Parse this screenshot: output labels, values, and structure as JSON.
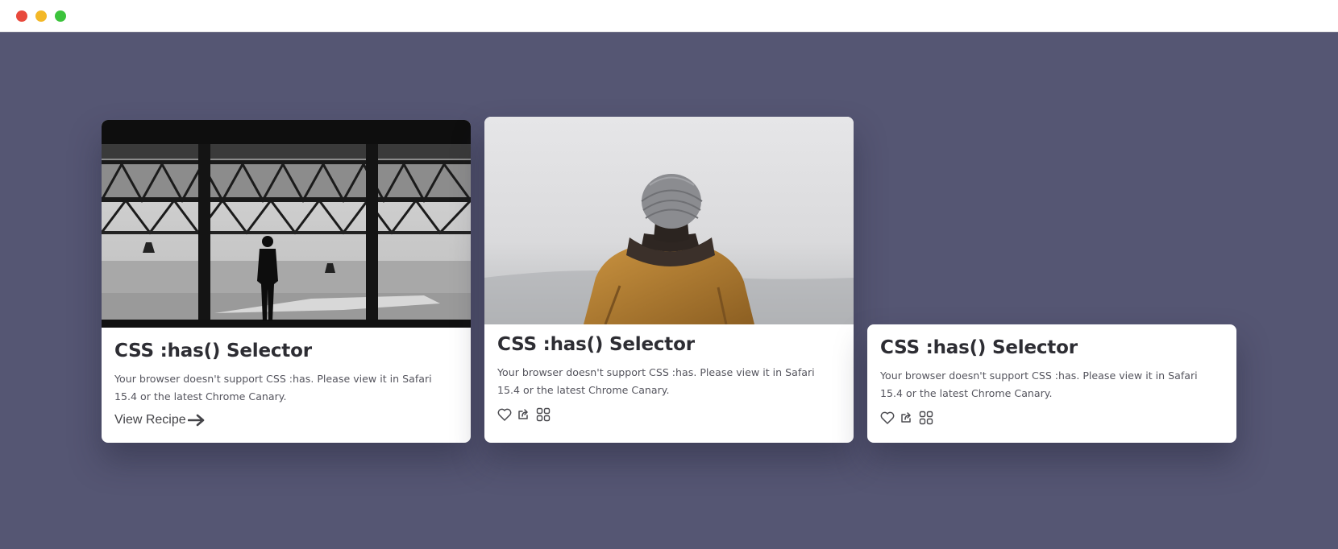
{
  "window": {
    "controls": {
      "close_color": "#e8493c",
      "minimize_color": "#f3b827",
      "zoom_color": "#3cc33c"
    }
  },
  "stage": {
    "background": "#555673"
  },
  "cards": [
    {
      "image": "man-silhouette-airport-window-photo",
      "title": "CSS :has() Selector",
      "text": "Your browser doesn't support CSS :has. Please view it in Safari 15.4 or the latest Chrome Canary.",
      "link_label": "View Recipe",
      "link_icon": "arrow-right-icon"
    },
    {
      "image": "person-knit-beanie-hooded-jacket-fog-photo",
      "title": "CSS :has() Selector",
      "text": "Your browser doesn't support CSS :has. Please view it in Safari 15.4 or the latest Chrome Canary.",
      "actions": [
        "heart-icon",
        "share-icon",
        "grid-icon"
      ]
    },
    {
      "title": "CSS :has() Selector",
      "text": "Your browser doesn't support CSS :has. Please view it in Safari 15.4 or the latest Chrome Canary.",
      "actions": [
        "heart-icon",
        "share-icon",
        "grid-icon"
      ]
    }
  ]
}
